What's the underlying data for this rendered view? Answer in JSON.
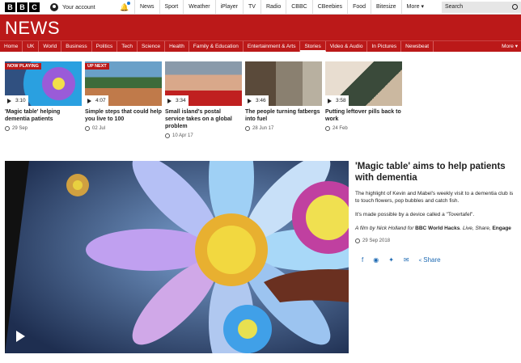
{
  "brand": {
    "letters": [
      "B",
      "B",
      "C"
    ],
    "news": "NEWS"
  },
  "topbar": {
    "account": "Your account",
    "nav": [
      "News",
      "Sport",
      "Weather",
      "iPlayer",
      "TV",
      "Radio",
      "CBBC",
      "CBeebies",
      "Food",
      "Bitesize",
      "More"
    ],
    "search_placeholder": "Search"
  },
  "subnav": {
    "items": [
      "Home",
      "UK",
      "World",
      "Business",
      "Politics",
      "Tech",
      "Science",
      "Health",
      "Family & Education",
      "Entertainment & Arts",
      "Stories",
      "Video & Audio",
      "In Pictures",
      "Newsbeat"
    ],
    "more": "More",
    "active": "Stories"
  },
  "cards": [
    {
      "flag": "NOW PLAYING",
      "duration": "3:10",
      "title": "'Magic table' helping dementia patients",
      "date": "29 Sep"
    },
    {
      "flag": "UP NEXT",
      "duration": "4:07",
      "title": "Simple steps that could help you live to 100",
      "date": "02 Jul"
    },
    {
      "flag": "",
      "duration": "3:34",
      "title": "Small island's postal service takes on a global problem",
      "date": "10 Apr 17"
    },
    {
      "flag": "",
      "duration": "3:46",
      "title": "The people turning fatbergs into fuel",
      "date": "28 Jun 17"
    },
    {
      "flag": "",
      "duration": "3:58",
      "title": "Putting leftover pills back to work",
      "date": "24 Feb"
    }
  ],
  "article": {
    "title": "'Magic table' aims to help patients with dementia",
    "p1": "The highlight of Kevin and Mabel's weekly visit to a dementia club is to touch flowers, pop bubbles and catch fish.",
    "p2": "It's made possible by a device called a \"Tovertafel\".",
    "credit_prefix": "A film by Nick Holland for ",
    "credit_source": "BBC World Hacks",
    "credit_mid": ". Live, Share, ",
    "credit_end": "Engage",
    "date": "29 Sep 2018",
    "share_label": "Share"
  }
}
